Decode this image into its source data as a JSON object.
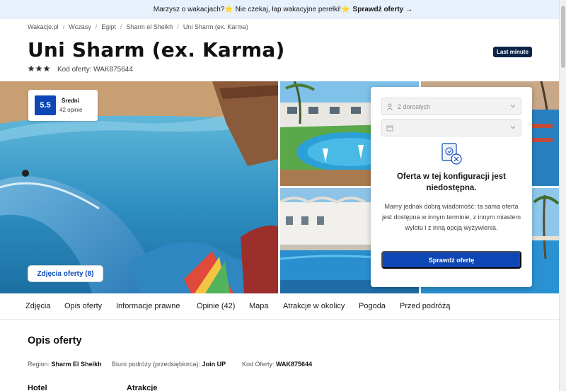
{
  "promo": {
    "text": "Marzysz o wakacjach?⭐ Nie czekaj, łap wakacyjne perełki!⭐",
    "cta": "Sprawdź oferty",
    "arrow": "→"
  },
  "breadcrumb": [
    "Wakacje.pl",
    "Wczasy",
    "Egipt",
    "Sharm el Sheikh",
    "Uni Sharm (ex. Karma)"
  ],
  "breadcrumb_sep": "/",
  "hotel": {
    "title": "Uni Sharm (ex. Karma)",
    "stars": 3,
    "offer_code_label": "Kod oferty: WAK875644",
    "badge": "Last minute"
  },
  "rating": {
    "score": "5.5",
    "label": "Średni",
    "count": "42 opinie"
  },
  "gallery": {
    "photos_button": "Zdjęcia oferty (8)"
  },
  "booking": {
    "guests": "2 dorosłych",
    "date": "",
    "unavailable_title": "Oferta w tej konfiguracji jest niedostępna.",
    "unavailable_text": "Mamy jednak dobrą wiadomość: ta sama oferta jest dostępna w innym terminie, z innym miastem wylotu i z inną opcją wyżywienia.",
    "button": "Sprawdź ofertę"
  },
  "tabs": [
    "Zdjęcia",
    "Opis oferty",
    "Informacje prawne",
    "Opinie (42)",
    "Mapa",
    "Atrakcje w okolicy",
    "Pogoda",
    "Przed podróżą"
  ],
  "description": {
    "title": "Opis oferty",
    "region_label": "Region:",
    "region_value": "Sharm El Sheikh",
    "agency_label": "Biuro podróży (przedsiębiorca):",
    "agency_value": "Join UP",
    "code_label": "Kod Oferty:",
    "code_value": "WAK875644",
    "col1": "Hotel",
    "col2": "Atrakcje"
  },
  "colors": {
    "brand": "#0d47b5",
    "badge": "#0b2447",
    "promo_bg": "#e7f0fb"
  }
}
